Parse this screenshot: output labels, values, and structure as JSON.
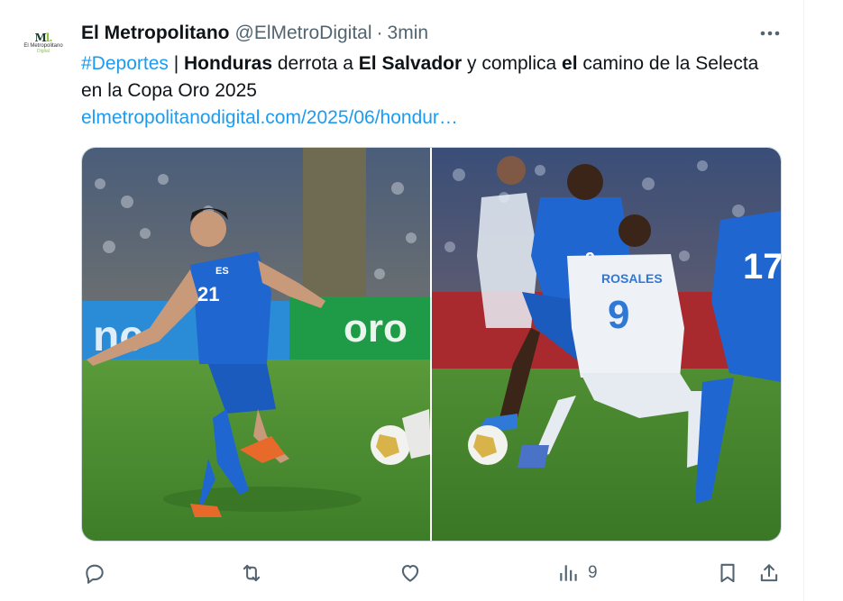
{
  "avatar": {
    "logo_mark": "M",
    "logo_text": "El Metropolitano",
    "logo_sub": "Digital"
  },
  "tweet": {
    "author_name": "El Metropolitano",
    "handle": "@ElMetroDigital",
    "separator": "·",
    "time": "3min",
    "text": {
      "hashtag": "#Deportes",
      "pipe": " | ",
      "bold1": "Honduras",
      "t1": " derrota a ",
      "bold2": "El Salvador",
      "t2": " y complica ",
      "bold3": "el",
      "t3": " camino de la Selecta en la Copa Oro 2025",
      "link": "elmetropolitanodigital.com/2025/06/hondur…"
    }
  },
  "media": {
    "left_photo": {
      "jersey_badge": "ES",
      "jersey_number": "21",
      "ad_text": "oro"
    },
    "right_photo": {
      "player_name": "ROSALES",
      "jersey_number": "9",
      "blue_number_a": "9",
      "blue_number_b": "17"
    }
  },
  "actions": {
    "views_count": "9"
  },
  "colors": {
    "accent": "#1d9bf0",
    "text_primary": "#0f1419",
    "text_secondary": "#536471",
    "pitch": "#3f8a2c",
    "jersey_blue": "#1f66d1"
  }
}
